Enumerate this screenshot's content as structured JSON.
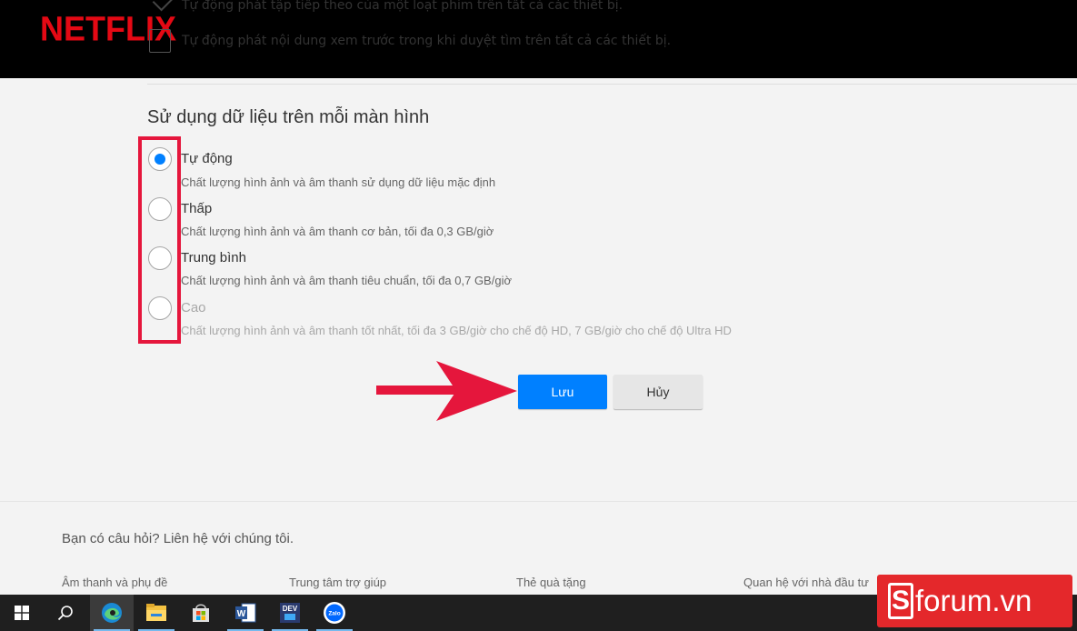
{
  "header": {
    "logo": "NETFLIX",
    "option_autoplay_next": "Tự động phát tập tiếp theo của một loạt phim trên tất cả các thiết bị.",
    "option_autoplay_previews": "Tự động phát nội dung xem trước trong khi duyệt tìm trên tất cả các thiết bị."
  },
  "data_usage": {
    "title": "Sử dụng dữ liệu trên mỗi màn hình",
    "options": [
      {
        "label": "Tự động",
        "description": "Chất lượng hình ảnh và âm thanh sử dụng dữ liệu mặc định",
        "selected": true,
        "disabled": false
      },
      {
        "label": "Thấp",
        "description": "Chất lượng hình ảnh và âm thanh cơ bản, tối đa 0,3 GB/giờ",
        "selected": false,
        "disabled": false
      },
      {
        "label": "Trung bình",
        "description": "Chất lượng hình ảnh và âm thanh tiêu chuẩn, tối đa 0,7 GB/giờ",
        "selected": false,
        "disabled": false
      },
      {
        "label": "Cao",
        "description": "Chất lượng hình ảnh và âm thanh tốt nhất, tối đa 3 GB/giờ cho chế độ HD, 7 GB/giờ cho chế độ Ultra HD",
        "selected": false,
        "disabled": true
      }
    ]
  },
  "actions": {
    "save_label": "Lưu",
    "cancel_label": "Hủy"
  },
  "footer": {
    "question": "Bạn có câu hỏi? Liên hệ với chúng tôi.",
    "links": [
      "Âm thanh và phụ đề",
      "Trung tâm trợ giúp",
      "Thẻ quà tặng",
      "Quan hệ với nhà đầu tư"
    ]
  },
  "taskbar": {
    "icons": [
      "windows-start-icon",
      "search-icon",
      "edge-icon",
      "file-explorer-icon",
      "store-icon",
      "word-icon",
      "dev-icon",
      "zalo-icon"
    ],
    "dev_text": "DEV",
    "word_text": "W",
    "zalo_text": "Zalo"
  },
  "watermark": {
    "brand_letter": "S",
    "brand_text": "forum.vn"
  },
  "colors": {
    "netflix_red": "#e50914",
    "accent_blue": "#0080ff",
    "annotation_red": "#e5163c",
    "watermark_red": "#e4282b"
  }
}
